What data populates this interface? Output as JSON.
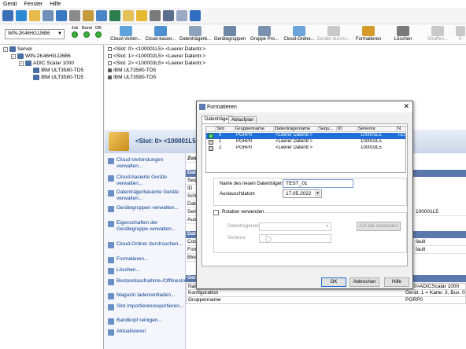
{
  "menu": [
    "Gerät",
    "Fenster",
    "Hilfe"
  ],
  "server_select": {
    "value": "WIN-2K46HGJJ6B6"
  },
  "status_indicators": [
    {
      "label": "Job"
    },
    {
      "label": "Band"
    },
    {
      "label": "DB"
    }
  ],
  "actions_toolbar": [
    {
      "label": "Cloud-Verbin..."
    },
    {
      "label": "Cloud-basier..."
    },
    {
      "label": "Datenträgerb..."
    },
    {
      "label": "Gerätegruppen"
    },
    {
      "label": "Gruppe Pro..."
    },
    {
      "label": "Cloud-Ordne..."
    },
    {
      "label": "Geräte durchs..."
    },
    {
      "label": "Formatieren"
    },
    {
      "label": "Löschen"
    },
    {
      "label": "Straffen..."
    },
    {
      "label": "K"
    }
  ],
  "tree": {
    "root": "Server",
    "server": "WIN-2K46HGJJ6B6",
    "library": "ADIC Scalar 1000",
    "drives": [
      "IBM ULT3580-TD5",
      "IBM ULT3580-TD5"
    ]
  },
  "slot_list": [
    "<Slot: 0> <100001L5> <Leerer Datentr.>",
    "<Slot: 1> <100002L5> <Leerer Datentr.>",
    "<Slot: 2> <100003L5> <Leerer Datentr.>",
    "IBM ULT3580-TD5",
    "IBM ULT3580-TD5"
  ],
  "detail": {
    "title": "<Slot: 0> <100001L5",
    "actions": [
      "Cloud-Verbindungen verwalten...",
      "Cloud-basierte Geräte verwalten...",
      "Datenträgerbasierte Geräte verwalten...",
      "Gerätegruppen verwalten...",
      "Eigenschaften der Gerätegruppe verwalten...",
      "Cloud-Ordner durchsuchen...",
      "Formatieren...",
      "Löschen...",
      "Bestandsaufnahme-/Offlineslots...",
      "Magazin laden/entladen...",
      "Slot importieren/exportieren...",
      "Bandkopf reinigen...",
      "Aktualisieren"
    ],
    "props_left": [
      "Zus",
      "Date",
      "Seq",
      "ID",
      "Sch",
      "Date",
      "Seri",
      "Aus",
      "Date",
      "Cod",
      "Forr",
      "Bloc",
      "Ger"
    ],
    "props_right": [
      "100001L5",
      "fault",
      "fault",
      "lot: 0>ADICScalar 1000"
    ],
    "bottom_rows": [
      {
        "name": "Name",
        "value": "lot: 0>ADICScalar 1000"
      },
      {
        "name": "Konfiguration",
        "value": "Gerät: 1 = Karte: 3, Bus: 0"
      },
      {
        "name": "Gruppenname",
        "value": "PGRP0"
      }
    ]
  },
  "dialog": {
    "title": "Formatieren",
    "tabs": [
      "Datenträger",
      "Ablaufplan"
    ],
    "columns": [
      "Slot",
      "Gruppenname",
      "Datenträgername",
      "Sequ...",
      "ID",
      "Seriennr.",
      "N"
    ],
    "rows": [
      {
        "slot": "0",
        "group": "PGRP0",
        "name": "<Leerer Datentr.>",
        "serial": "100001L5",
        "extra": "TEST",
        "selected": true
      },
      {
        "slot": "1",
        "group": "PGRP0",
        "name": "<Leerer Datentr.>",
        "serial": "100002L5",
        "extra": "",
        "selected": false
      },
      {
        "slot": "2",
        "group": "PGRP0",
        "name": "<Leerer Datentr.>",
        "serial": "100003L5",
        "extra": "",
        "selected": false
      }
    ],
    "new_name_label": "Name des neuen Datenträgers",
    "new_name_value": "TEST_01",
    "swap_date_label": "Austauschdatum",
    "swap_date_value": "17.05.2022",
    "rotation_label": "Rotation verwenden",
    "media_set_label": "Datenträgerset",
    "serial_label": "Seriennr.",
    "apply_all_label": "Auf alle anwenden",
    "ok": "OK",
    "cancel": "Abbrechen",
    "help": "Hilfe"
  }
}
